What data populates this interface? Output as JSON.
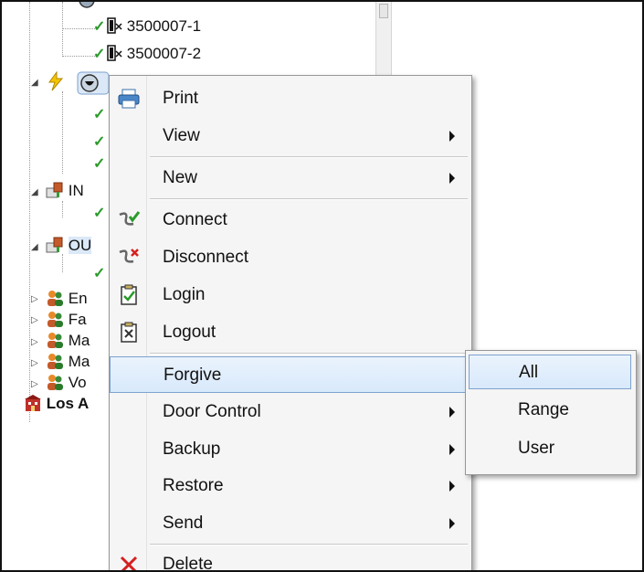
{
  "tree": {
    "items": [
      {
        "label": "3500007-1"
      },
      {
        "label": "3500007-2"
      },
      {
        "label": "IN"
      },
      {
        "label": "OU"
      },
      {
        "label": "En"
      },
      {
        "label": "Fa"
      },
      {
        "label": "Ma"
      },
      {
        "label": "Ma"
      },
      {
        "label": "Vo"
      },
      {
        "label": "Los A"
      }
    ]
  },
  "context_menu": {
    "items": [
      {
        "label": "Print",
        "icon": "printer-icon"
      },
      {
        "label": "View",
        "submenu": true
      },
      {
        "label": "New",
        "submenu": true
      },
      {
        "label": "Connect",
        "icon": "connect-icon"
      },
      {
        "label": "Disconnect",
        "icon": "disconnect-icon"
      },
      {
        "label": "Login",
        "icon": "login-icon"
      },
      {
        "label": "Logout",
        "icon": "logout-icon"
      },
      {
        "label": "Forgive",
        "highlighted": true
      },
      {
        "label": "Door Control",
        "submenu": true
      },
      {
        "label": "Backup",
        "submenu": true
      },
      {
        "label": "Restore",
        "submenu": true
      },
      {
        "label": "Send",
        "submenu": true
      },
      {
        "label": "Delete",
        "icon": "delete-icon"
      }
    ]
  },
  "forgive_submenu": {
    "items": [
      {
        "label": "All",
        "highlighted": true
      },
      {
        "label": "Range"
      },
      {
        "label": "User"
      }
    ]
  },
  "colors": {
    "highlight_border": "#7da2ce",
    "highlight_fill": "#d8e9fb",
    "check_green": "#2a9a2a",
    "delete_red": "#d42020"
  }
}
